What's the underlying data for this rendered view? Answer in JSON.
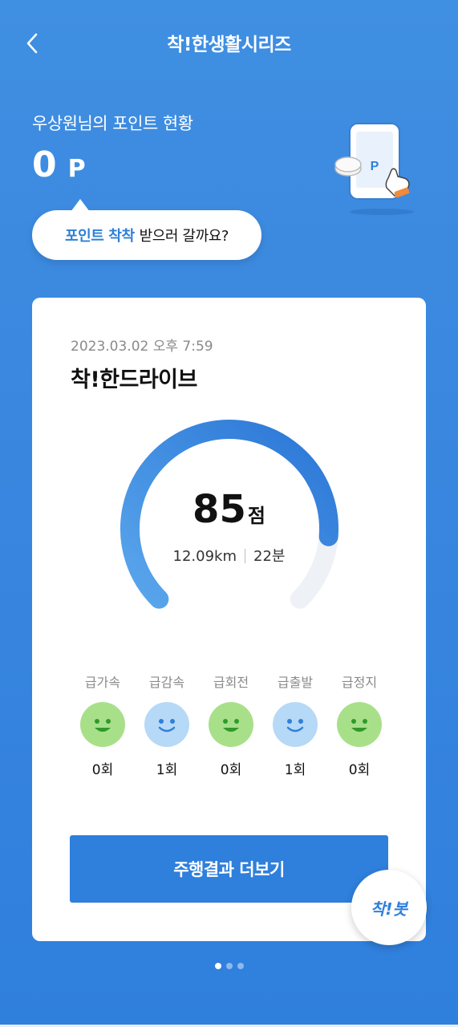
{
  "header": {
    "title": "착!한생활시리즈"
  },
  "points": {
    "label": "우상원님의 포인트 현황",
    "value": "0",
    "unit": "P"
  },
  "bubble": {
    "highlight": "포인트 착착",
    "text": "받으러 갈까요?"
  },
  "card": {
    "date": "2023.03.02 오후 7:59",
    "title": "착!한드라이브",
    "score": "85",
    "score_unit": "점",
    "score_fraction": 0.85,
    "distance": "12.09km",
    "duration": "22분",
    "events": [
      {
        "label": "급가속",
        "count": "0회",
        "mood": "green"
      },
      {
        "label": "급감속",
        "count": "1회",
        "mood": "blue"
      },
      {
        "label": "급회전",
        "count": "0회",
        "mood": "green"
      },
      {
        "label": "급출발",
        "count": "1회",
        "mood": "blue"
      },
      {
        "label": "급정지",
        "count": "0회",
        "mood": "green"
      }
    ],
    "more_button": "주행결과 더보기"
  },
  "chakbot": {
    "label": "착!봇"
  },
  "pagination": {
    "total": 3,
    "active": 0
  },
  "colors": {
    "accent": "#2f7fdc",
    "good": "#a8e08a",
    "fair": "#b6d9f7"
  }
}
